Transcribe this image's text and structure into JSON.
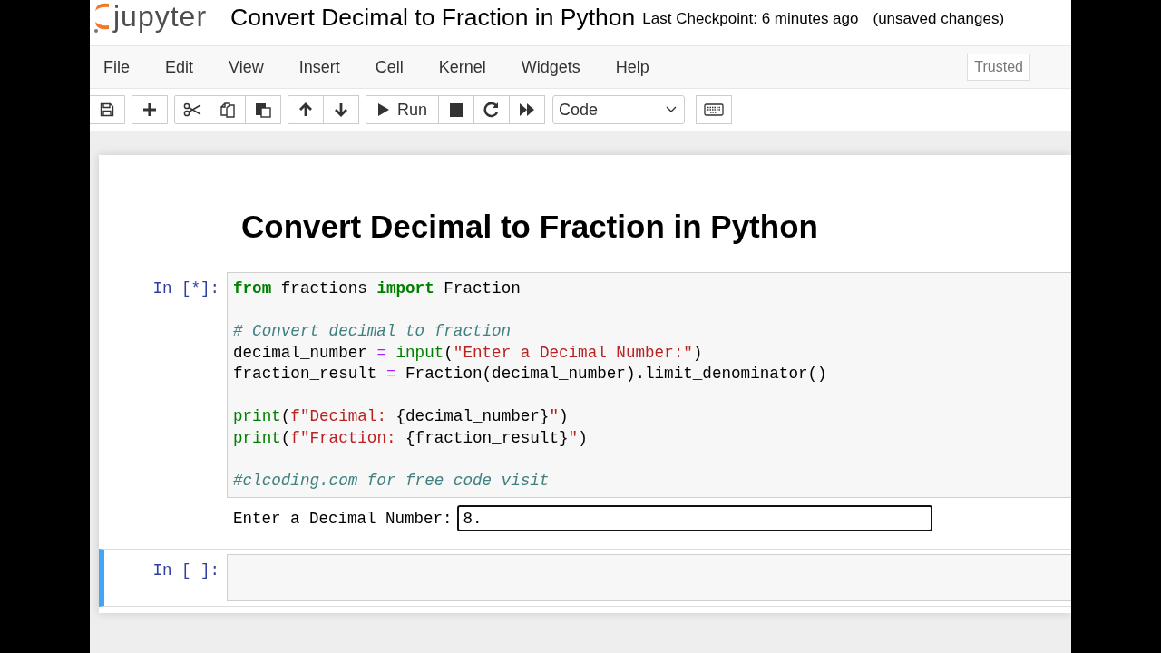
{
  "header": {
    "logo_text": "jupyter",
    "notebook_title": "Convert Decimal to Fraction in Python",
    "checkpoint": "Last Checkpoint: 6 minutes ago",
    "save_status": "(unsaved changes)"
  },
  "menu": [
    "File",
    "Edit",
    "View",
    "Insert",
    "Cell",
    "Kernel",
    "Widgets",
    "Help"
  ],
  "trusted_badge": "Trusted",
  "toolbar": {
    "groups": [
      [
        {
          "kind": "save"
        }
      ],
      [
        {
          "kind": "add"
        }
      ],
      [
        {
          "kind": "cut"
        },
        {
          "kind": "copy"
        },
        {
          "kind": "paste"
        }
      ],
      [
        {
          "kind": "up"
        },
        {
          "kind": "down"
        }
      ],
      [
        {
          "kind": "run",
          "label": "Run"
        },
        {
          "kind": "stop"
        },
        {
          "kind": "restart"
        },
        {
          "kind": "fastforward"
        }
      ]
    ],
    "cell_type": "Code"
  },
  "cells": [
    {
      "kind": "markdown",
      "selected": false,
      "heading": "Convert Decimal to Fraction in Python"
    },
    {
      "kind": "code",
      "selected": false,
      "prompt": "In [*]:",
      "blocks": [
        [
          [
            {
              "kind": "kw",
              "text": "from"
            },
            {
              "kind": "plain",
              "text": " fractions "
            },
            {
              "kind": "kw",
              "text": "import"
            },
            {
              "kind": "plain",
              "text": " Fraction"
            }
          ]
        ],
        [
          [
            {
              "kind": "comment",
              "text": "# Convert decimal to fraction"
            }
          ],
          [
            {
              "kind": "plain",
              "text": "decimal_number "
            },
            {
              "kind": "op",
              "text": "= "
            },
            {
              "kind": "builtin",
              "text": "input"
            },
            {
              "kind": "plain",
              "text": "("
            },
            {
              "kind": "str",
              "text": "\"Enter a Decimal Number:\""
            },
            {
              "kind": "plain",
              "text": ")"
            }
          ],
          [
            {
              "kind": "plain",
              "text": "fraction_result "
            },
            {
              "kind": "op",
              "text": "="
            },
            {
              "kind": "plain",
              "text": " Fraction(decimal_number).limit_denominator()"
            }
          ]
        ],
        [
          [
            {
              "kind": "builtin",
              "text": "print"
            },
            {
              "kind": "plain",
              "text": "("
            },
            {
              "kind": "str",
              "text": "f\"Decimal: "
            },
            {
              "kind": "plain",
              "text": "{decimal_number}"
            },
            {
              "kind": "str",
              "text": "\""
            },
            {
              "kind": "plain",
              "text": ")"
            }
          ],
          [
            {
              "kind": "builtin",
              "text": "print"
            },
            {
              "kind": "plain",
              "text": "("
            },
            {
              "kind": "str",
              "text": "f\"Fraction: "
            },
            {
              "kind": "plain",
              "text": "{fraction_result}"
            },
            {
              "kind": "str",
              "text": "\""
            },
            {
              "kind": "plain",
              "text": ")"
            }
          ]
        ],
        [
          [
            {
              "kind": "comment",
              "text": "#clcoding.com for free code visit"
            }
          ]
        ]
      ],
      "output": {
        "prompt_text": "Enter a Decimal Number:",
        "value": "8."
      }
    },
    {
      "kind": "code",
      "selected": true,
      "prompt": "In [ ]:"
    }
  ]
}
